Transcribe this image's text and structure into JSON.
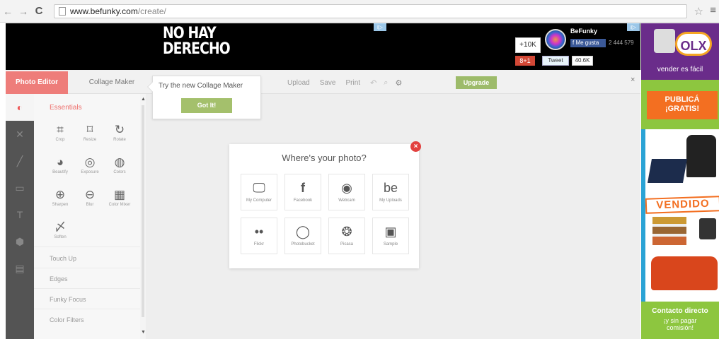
{
  "browser": {
    "url_host": "www.befunky.com",
    "url_path": "/create/",
    "back_glyph": "←",
    "fwd_glyph": "→",
    "reload_glyph": "C",
    "star_glyph": "☆",
    "menu_glyph": "≡"
  },
  "banner": {
    "headline": "NO HAY\nDERECHO",
    "ad_badge": "i▷",
    "count_badge": "+10K",
    "gplus": "8+1",
    "brand": "BeFunky",
    "fb_like": "f Me gusta",
    "fb_count": "2 444 579",
    "tweet": "Tweet",
    "tweet_count": "40.6K"
  },
  "side_ad": {
    "logo": "OLX",
    "tagline": "vender es fácil",
    "cta": "PUBLICÁ\n¡GRATIS!",
    "sold": "VENDIDO",
    "contact": "Contacto directo",
    "fine_print": "¡y sin pagar\ncomisión!"
  },
  "editor": {
    "tab_photo": "Photo Editor",
    "tab_collage": "Collage Maker",
    "toolbar": {
      "upload": "Upload",
      "save": "Save",
      "print": "Print",
      "upgrade": "Upgrade"
    },
    "close": "×",
    "popover": {
      "text": "Try the new Collage Maker",
      "button": "Got It!"
    },
    "panel": {
      "essentials": "Essentials",
      "tools": [
        {
          "label": "Crop",
          "glyph": "⌗"
        },
        {
          "label": "Resize",
          "glyph": "⌑"
        },
        {
          "label": "Rotate",
          "glyph": "↻"
        },
        {
          "label": "Beautify",
          "glyph": "◕"
        },
        {
          "label": "Exposure",
          "glyph": "◎"
        },
        {
          "label": "Colors",
          "glyph": "◍"
        },
        {
          "label": "Sharpen",
          "glyph": "⊕"
        },
        {
          "label": "Blur",
          "glyph": "⊖"
        },
        {
          "label": "Color Mixer",
          "glyph": "▦"
        },
        {
          "label": "Soften",
          "glyph": "〆"
        }
      ],
      "sections": [
        "Touch Up",
        "Edges",
        "Funky Focus",
        "Color Filters"
      ]
    },
    "iconbar": [
      "◐",
      "✕",
      "╱",
      "▭",
      "T",
      "⬢",
      "▤"
    ]
  },
  "dialog": {
    "title": "Where's your photo?",
    "sources": [
      {
        "label": "My Computer",
        "glyph": "🖵"
      },
      {
        "label": "Facebook",
        "glyph": "f"
      },
      {
        "label": "Webcam",
        "glyph": "◉"
      },
      {
        "label": "My Uploads",
        "glyph": "be"
      },
      {
        "label": "Flickr",
        "glyph": "••"
      },
      {
        "label": "Photobucket",
        "glyph": "◯"
      },
      {
        "label": "Picasa",
        "glyph": "❂"
      },
      {
        "label": "Sample",
        "glyph": "▣"
      }
    ]
  }
}
